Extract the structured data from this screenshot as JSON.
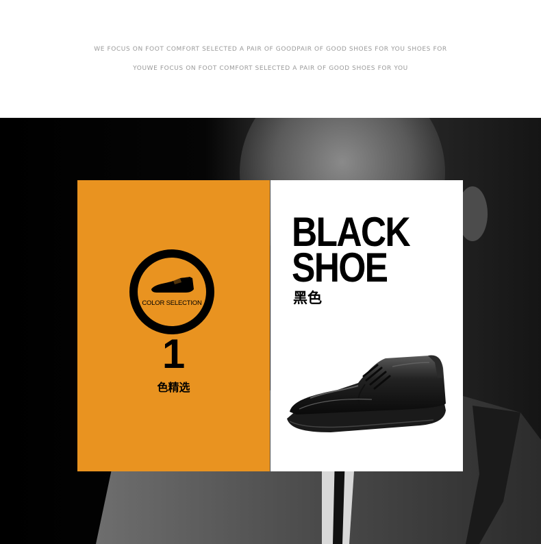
{
  "header": {
    "tagline_line1": "WE FOCUS ON FOOT COMFORT SELECTED A PAIR OF GOODPAIR OF GOOD SHOES FOR YOU SHOES FOR",
    "tagline_line2": "YOUWE FOCUS ON FOOT COMFORT SELECTED A PAIR OF GOOD SHOES FOR YOU"
  },
  "color_card": {
    "badge_icon": "shoe-icon",
    "badge_label": "COLOR SELECTION",
    "count": "1",
    "count_label": "色精选",
    "background_color": "#e99320"
  },
  "product_card": {
    "title_line1": "BLACK",
    "title_line2": "SHOE",
    "color_name": "黑色",
    "image": "black-leather-derby-shoe"
  },
  "background": {
    "image": "man-in-suit-grayscale-photo"
  }
}
